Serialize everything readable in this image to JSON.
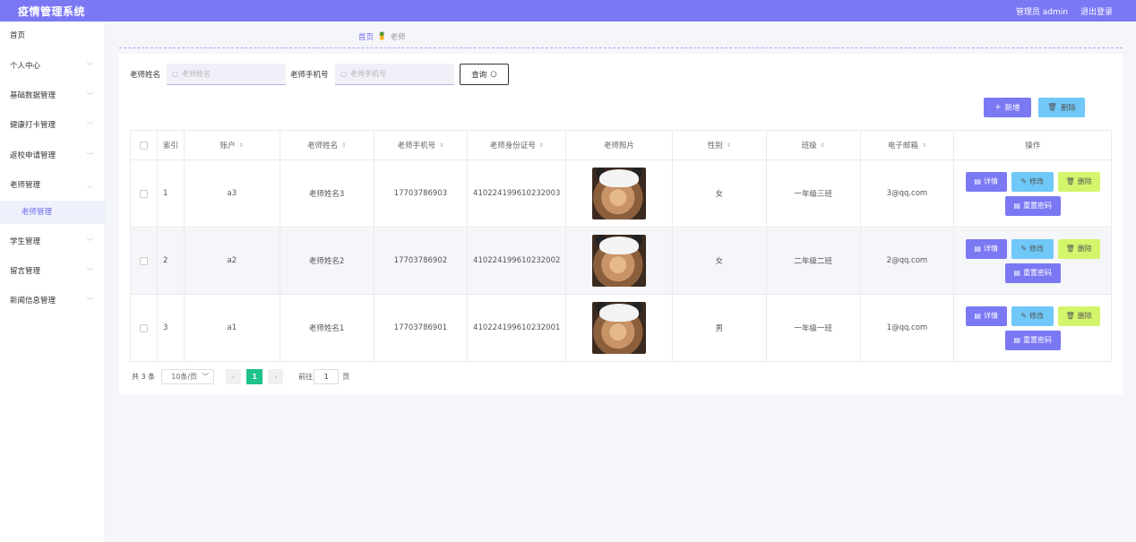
{
  "header": {
    "title": "疫情管理系统",
    "user": "管理员 admin",
    "logout": "退出登录"
  },
  "sidebar": {
    "items": [
      {
        "label": "首页"
      },
      {
        "label": "个人中心"
      },
      {
        "label": "基础数据管理"
      },
      {
        "label": "健康打卡管理"
      },
      {
        "label": "返校申请管理"
      },
      {
        "label": "老师管理"
      },
      {
        "label": "老师管理"
      },
      {
        "label": "学生管理"
      },
      {
        "label": "留言管理"
      },
      {
        "label": "新闻信息管理"
      }
    ]
  },
  "breadcrumb": {
    "home": "首页",
    "current": "老师"
  },
  "search": {
    "name_label": "老师姓名",
    "name_placeholder": "老师姓名",
    "phone_label": "老师手机号",
    "phone_placeholder": "老师手机号",
    "query": "查询"
  },
  "toolbar": {
    "add": "新增",
    "delete": "删除"
  },
  "table": {
    "headers": [
      "索引",
      "账户",
      "老师姓名",
      "老师手机号",
      "老师身份证号",
      "老师照片",
      "性别",
      "班级",
      "电子邮箱",
      "操作"
    ],
    "rows": [
      {
        "index": "1",
        "account": "a3",
        "name": "老师姓名3",
        "phone": "17703786903",
        "idcard": "410224199610232003",
        "gender": "女",
        "class": "一年级三班",
        "email": "3@qq.com"
      },
      {
        "index": "2",
        "account": "a2",
        "name": "老师姓名2",
        "phone": "17703786902",
        "idcard": "410224199610232002",
        "gender": "女",
        "class": "二年级二班",
        "email": "2@qq.com"
      },
      {
        "index": "3",
        "account": "a1",
        "name": "老师姓名1",
        "phone": "17703786901",
        "idcard": "410224199610232001",
        "gender": "男",
        "class": "一年级一班",
        "email": "1@qq.com"
      }
    ],
    "actions": {
      "detail": "详情",
      "edit": "修改",
      "delete": "删除",
      "reset": "重置密码"
    }
  },
  "pagination": {
    "total": "共 3 条",
    "page_size": "10条/页",
    "current": "1",
    "goto": "前往",
    "goto_value": "1",
    "page_suffix": "页"
  },
  "colors": {
    "accent": "#7b78f4",
    "info": "#70c8f8",
    "warn": "#d4f56b",
    "active_page": "#1ec28b"
  }
}
